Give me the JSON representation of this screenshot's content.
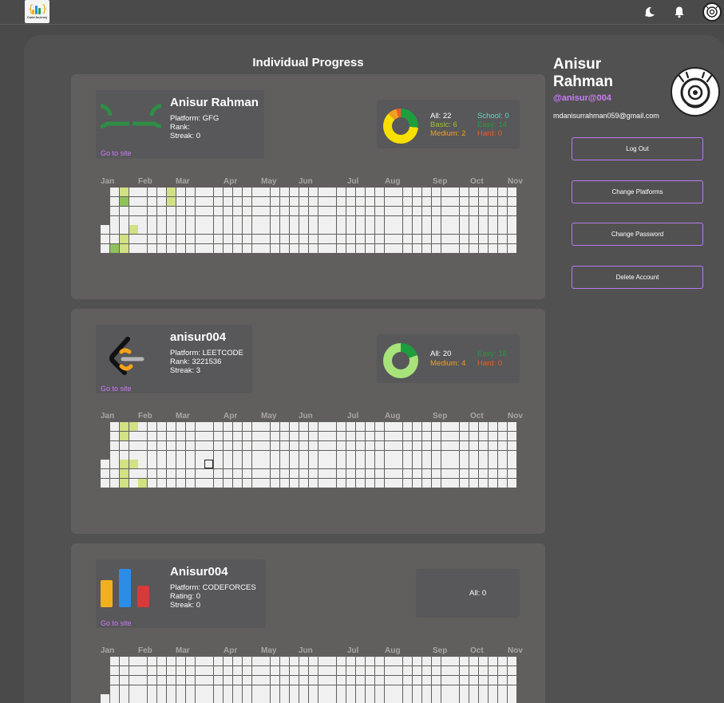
{
  "header": {
    "logo_text": "CodeJourney",
    "moon_icon": "moon-icon",
    "bell_icon": "bell-icon",
    "avatar_icon": "avatar-icon"
  },
  "main": {
    "title": "Individual Progress",
    "go_to_site": "Go to site"
  },
  "months": [
    "Jan",
    "Feb",
    "Mar",
    "Apr",
    "May",
    "Jun",
    "Jul",
    "Aug",
    "Sep",
    "Oct",
    "Nov"
  ],
  "cards": [
    {
      "platform_logo": "geeksforgeeks-logo",
      "username": "Anisur Rahman",
      "platform": "Platform: GFG",
      "rank": "Rank:",
      "streak": "Streak: 0",
      "stats": {
        "all": "All: 22",
        "school": "School: 0",
        "basic": "Basic: 6",
        "easy": "Easy: 14",
        "medium": "Medium: 2",
        "hard": "Hard: 0"
      },
      "activity": [
        [
          2,
          0,
          1
        ],
        [
          2,
          1,
          2
        ],
        [
          2,
          5,
          1
        ],
        [
          2,
          6,
          1
        ],
        [
          1,
          6,
          2
        ],
        [
          3,
          4,
          1
        ],
        [
          7,
          0,
          1
        ],
        [
          7,
          1,
          1
        ]
      ]
    },
    {
      "platform_logo": "leetcode-logo",
      "username": "anisur004",
      "platform": "Platform: LEETCODE",
      "rank": "Rank: 3221536",
      "streak": "Streak: 3",
      "stats": {
        "all": "All: 20",
        "easy": "Easy: 16",
        "medium": "Medium: 4",
        "hard": "Hard: 0"
      },
      "activity": [
        [
          2,
          0,
          1
        ],
        [
          2,
          1,
          1
        ],
        [
          3,
          0,
          1
        ],
        [
          2,
          4,
          1
        ],
        [
          2,
          5,
          1
        ],
        [
          2,
          6,
          1
        ],
        [
          3,
          4,
          1
        ],
        [
          4,
          6,
          1
        ]
      ]
    },
    {
      "platform_logo": "codeforces-logo",
      "username": "Anisur004",
      "platform": "Platform: CODEFORCES",
      "rating": "Rating: 0",
      "streak": "Streak: 0",
      "stats": {
        "all": "All: 0"
      },
      "activity": []
    }
  ],
  "profile": {
    "name": "Anisur Rahman",
    "handle": "@anisur@004",
    "email": "mdanisurrahman059@gmail.com",
    "avatar_icon": "profile-avatar-icon"
  },
  "actions": {
    "logout": "Log Out",
    "change_platforms": "Change Platforms",
    "change_password": "Change Password",
    "delete_account": "Delete Account"
  },
  "colors": {
    "accent": "#c97cf6",
    "heat_low": "#d2e184",
    "heat_high": "#8fc25a",
    "easy": "#1e9e3e",
    "medium": "#f0a020",
    "hard": "#f05a28",
    "school": "#4ee0c0",
    "basic": "#9cc33a"
  }
}
